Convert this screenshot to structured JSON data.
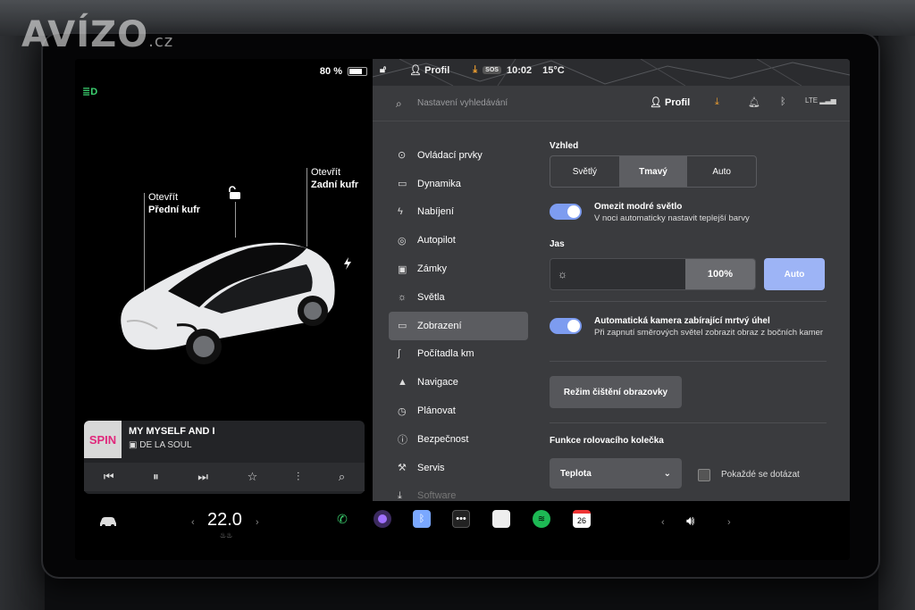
{
  "watermark": {
    "brand": "AVÍZO",
    "tld": ".cz"
  },
  "car": {
    "battery_percent": "80 %",
    "front_trunk_line1": "Otevřít",
    "front_trunk_line2": "Přední kufr",
    "rear_trunk_line1": "Otevřít",
    "rear_trunk_line2": "Zadní kufr"
  },
  "music": {
    "album_art_text": "SPIN",
    "song": "MY MYSELF AND I",
    "artist": "DE LA SOUL"
  },
  "status_bar": {
    "profile": "Profil",
    "sos": "SOS",
    "time": "10:02",
    "temperature": "15°C"
  },
  "settings_header": {
    "search_placeholder": "Nastavení vyhledávání",
    "profile": "Profil",
    "signal": "LTE"
  },
  "menu": {
    "items": [
      {
        "label": "Ovládací prvky",
        "icon": "toggle-icon"
      },
      {
        "label": "Dynamika",
        "icon": "car-icon"
      },
      {
        "label": "Nabíjení",
        "icon": "bolt-icon"
      },
      {
        "label": "Autopilot",
        "icon": "steering-icon"
      },
      {
        "label": "Zámky",
        "icon": "lock-icon"
      },
      {
        "label": "Světla",
        "icon": "light-icon"
      },
      {
        "label": "Zobrazení",
        "icon": "display-icon"
      },
      {
        "label": "Počítadla km",
        "icon": "trip-icon"
      },
      {
        "label": "Navigace",
        "icon": "navigation-icon"
      },
      {
        "label": "Plánovat",
        "icon": "clock-icon"
      },
      {
        "label": "Bezpečnost",
        "icon": "info-icon"
      },
      {
        "label": "Servis",
        "icon": "wrench-icon"
      },
      {
        "label": "Software",
        "icon": "download-icon"
      }
    ]
  },
  "display": {
    "appearance_title": "Vzhled",
    "appearance_options": [
      "Světlý",
      "Tmavý",
      "Auto"
    ],
    "appearance_selected": "Tmavý",
    "blue_light_title": "Omezit modré světlo",
    "blue_light_desc": "V noci automaticky nastavit teplejší barvy",
    "blue_light_on": true,
    "brightness_title": "Jas",
    "brightness_value": "100%",
    "brightness_auto": "Auto",
    "blindspot_title": "Automatická kamera zabírající mrtvý úhel",
    "blindspot_desc": "Při zapnutí směrových světel zobrazit obraz z bočních kamer",
    "blindspot_on": true,
    "clean_mode": "Režim čištění obrazovky",
    "scroll_title": "Funkce rolovacího kolečka",
    "scroll_value": "Teplota",
    "ask_every_time": "Pokaždé se dotázat"
  },
  "taskbar": {
    "cabin_temp": "22.0",
    "calendar_day": "26"
  }
}
